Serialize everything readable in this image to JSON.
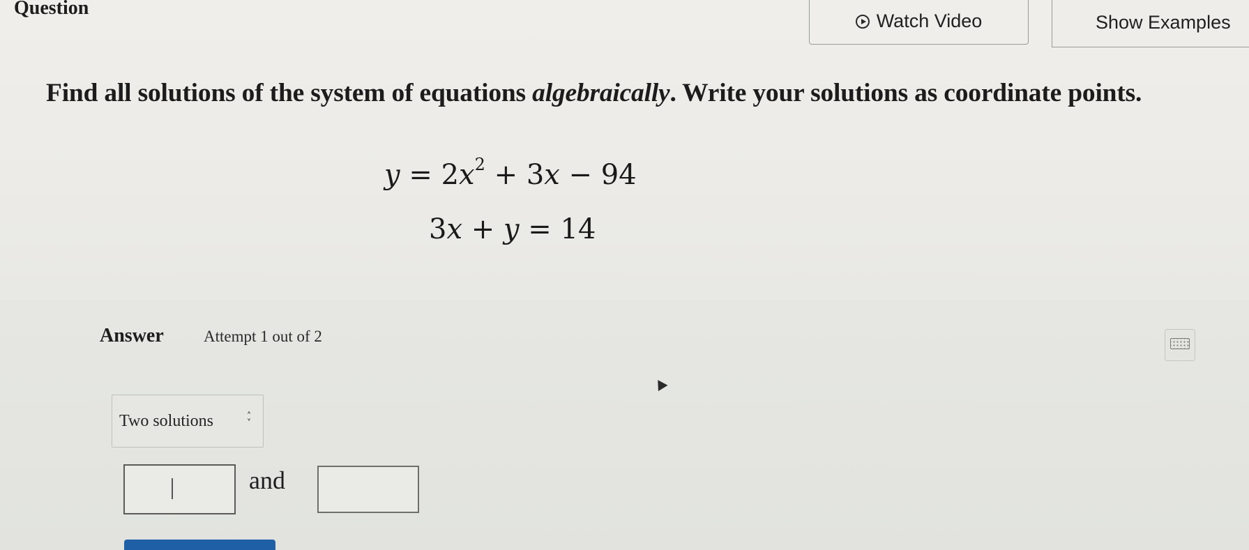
{
  "header": {
    "title": "Question",
    "watch_video_label": "Watch Video",
    "show_examples_label": "Show Examples"
  },
  "question": {
    "prompt_start": "Find all solutions of the system of equations ",
    "prompt_emphasis": "algebraically",
    "prompt_end": ". Write your solutions as coordinate points."
  },
  "equations": {
    "eq1": {
      "lhs": "y",
      "rel": " = ",
      "t1": "2",
      "var": "x",
      "exp": "2",
      "rest_op1": " + ",
      "t2": "3",
      "t2var": "x",
      "rest_op2": " − ",
      "t3": "94"
    },
    "eq2": {
      "t1": "3",
      "t1var": "x",
      "op": " + ",
      "t2var": "y",
      "rel": " = ",
      "rhs": "14"
    }
  },
  "answer": {
    "label": "Answer",
    "attempt_text": "Attempt 1 out of 2",
    "solutions_select_value": "Two solutions",
    "conjunction": "and"
  },
  "icons": {
    "play": "play-circle-icon",
    "keyboard": "keyboard-icon",
    "select_chevron": "up-down-chevron-icon"
  },
  "colors": {
    "submit_accent": "#1f5fa6"
  }
}
